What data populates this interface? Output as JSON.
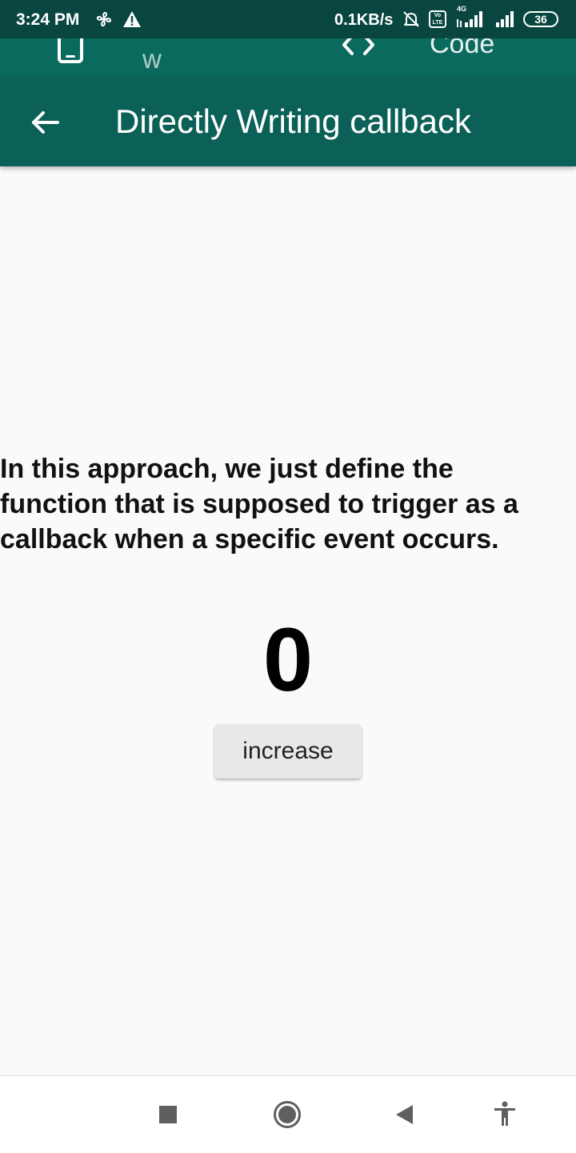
{
  "status_bar": {
    "time": "3:24 PM",
    "network_speed": "0.1KB/s",
    "volte_label": "Vo LTE",
    "network_type": "4G",
    "battery": "36",
    "icons": [
      "fan-icon",
      "warning-icon",
      "bell-off-icon",
      "signal-icon",
      "signal-icon",
      "battery-icon"
    ]
  },
  "tabs": [
    {
      "label": "Preview",
      "icon": "smartphone-icon"
    },
    {
      "label": "Code",
      "icon": "code-icon"
    }
  ],
  "app_bar": {
    "title": "Directly Writing callback",
    "back_icon": "arrow-back-icon"
  },
  "content": {
    "description": "In this approach, we just define the function that is supposed to trigger as a callback when a specific event occurs.",
    "counter": "0",
    "button_label": "increase"
  },
  "navigation_bar": {
    "icons": [
      "recent-apps-icon",
      "home-icon",
      "back-icon",
      "accessibility-icon"
    ]
  },
  "colors": {
    "status_bar": "#08463f",
    "tab_bar": "#0b6a5e",
    "app_bar": "#0b6057",
    "background": "#fafafa",
    "button": "#e8e8e8"
  }
}
